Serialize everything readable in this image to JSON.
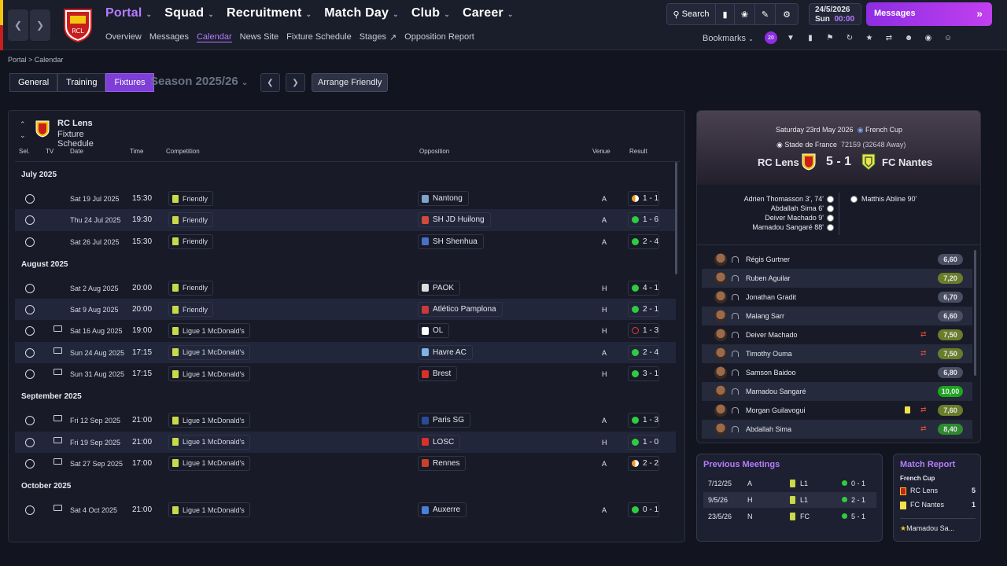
{
  "nav": {
    "main_menu": [
      {
        "label": "Portal"
      },
      {
        "label": "Squad"
      },
      {
        "label": "Recruitment"
      },
      {
        "label": "Match Day"
      },
      {
        "label": "Club"
      },
      {
        "label": "Career"
      }
    ],
    "sub_menu": [
      "Overview",
      "Messages",
      "Calendar",
      "News Site",
      "Fixture Schedule",
      "Stages",
      "Opposition Report"
    ],
    "active_sub": "Calendar",
    "search_label": "Search",
    "date": "24/5/2026",
    "day": "Sun",
    "clock": "00:00",
    "messages_label": "Messages",
    "bookmarks_label": "Bookmarks",
    "bookmark_badge": "20"
  },
  "breadcrumb": {
    "root": "Portal",
    "current": "Calendar"
  },
  "filters": {
    "tabs": [
      "General",
      "Training",
      "Fixtures"
    ],
    "active": "Fixtures",
    "season": "Season 2025/26",
    "arrange_label": "Arrange Friendly"
  },
  "schedule": {
    "club": "RC Lens",
    "subtitle": "Fixture Schedule",
    "columns": [
      "Sel.",
      "TV",
      "Date",
      "Time",
      "Competition",
      "Opposition",
      "Venue",
      "Result"
    ],
    "months": [
      {
        "name": "July 2025",
        "rows": [
          {
            "date": "Sat 19 Jul 2025",
            "time": "15:30",
            "comp": "Friendly",
            "opp": "Nantong",
            "venue": "A",
            "result": "1 - 1",
            "outcome": "d",
            "tv": false,
            "oppColor": "#7fa3c9"
          },
          {
            "date": "Thu 24 Jul 2025",
            "time": "19:30",
            "comp": "Friendly",
            "opp": "SH JD Huilong",
            "venue": "A",
            "result": "1 - 6",
            "outcome": "w",
            "tv": false,
            "oppColor": "#d24a3a"
          },
          {
            "date": "Sat 26 Jul 2025",
            "time": "15:30",
            "comp": "Friendly",
            "opp": "SH Shenhua",
            "venue": "A",
            "result": "2 - 4",
            "outcome": "w",
            "tv": false,
            "oppColor": "#4a6fc9"
          }
        ]
      },
      {
        "name": "August 2025",
        "rows": [
          {
            "date": "Sat 2 Aug 2025",
            "time": "20:00",
            "comp": "Friendly",
            "opp": "PAOK",
            "venue": "H",
            "result": "4 - 1",
            "outcome": "w",
            "tv": false,
            "oppColor": "#dddddd"
          },
          {
            "date": "Sat 9 Aug 2025",
            "time": "20:00",
            "comp": "Friendly",
            "opp": "Atlético Pamplona",
            "venue": "H",
            "result": "2 - 1",
            "outcome": "w",
            "tv": false,
            "oppColor": "#c93a3a"
          },
          {
            "date": "Sat 16 Aug 2025",
            "time": "19:00",
            "comp": "Ligue 1 McDonald's",
            "opp": "OL",
            "venue": "H",
            "result": "1 - 3",
            "outcome": "l",
            "tv": true,
            "oppColor": "#ffffff"
          },
          {
            "date": "Sun 24 Aug 2025",
            "time": "17:15",
            "comp": "Ligue 1 McDonald's",
            "opp": "Havre AC",
            "venue": "A",
            "result": "2 - 4",
            "outcome": "w",
            "tv": true,
            "oppColor": "#7fb2e5"
          },
          {
            "date": "Sun 31 Aug 2025",
            "time": "17:15",
            "comp": "Ligue 1 McDonald's",
            "opp": "Brest",
            "venue": "H",
            "result": "3 - 1",
            "outcome": "w",
            "tv": true,
            "oppColor": "#d9302a"
          }
        ]
      },
      {
        "name": "September 2025",
        "rows": [
          {
            "date": "Fri 12 Sep 2025",
            "time": "21:00",
            "comp": "Ligue 1 McDonald's",
            "opp": "Paris SG",
            "venue": "A",
            "result": "1 - 3",
            "outcome": "w",
            "tv": true,
            "oppColor": "#2a4a9a"
          },
          {
            "date": "Fri 19 Sep 2025",
            "time": "21:00",
            "comp": "Ligue 1 McDonald's",
            "opp": "LOSC",
            "venue": "H",
            "result": "1 - 0",
            "outcome": "w",
            "tv": true,
            "oppColor": "#d9302a"
          },
          {
            "date": "Sat 27 Sep 2025",
            "time": "17:00",
            "comp": "Ligue 1 McDonald's",
            "opp": "Rennes",
            "venue": "A",
            "result": "2 - 2",
            "outcome": "d",
            "tv": true,
            "oppColor": "#c9402a"
          }
        ]
      },
      {
        "name": "October 2025",
        "rows": [
          {
            "date": "Sat 4 Oct 2025",
            "time": "21:00",
            "comp": "Ligue 1 McDonald's",
            "opp": "Auxerre",
            "venue": "A",
            "result": "0 - 1",
            "outcome": "w",
            "tv": true,
            "oppColor": "#4a7fd9"
          }
        ]
      }
    ]
  },
  "match": {
    "date": "Saturday 23rd May 2026",
    "competition": "French Cup",
    "stadium": "Stade de France",
    "attendance": "72159",
    "away_count": "(32648 Away)",
    "home": "RC Lens",
    "away": "FC Nantes",
    "score": "5 - 1",
    "home_scorers": [
      "Adrien Thomasson 3', 74'",
      "Abdallah Sima 6'",
      "Deiver Machado 9'",
      "Mamadou Sangaré 88'"
    ],
    "away_scorers": [
      "Matthis Abline 90'"
    ],
    "players": [
      {
        "name": "Régis Gurtner",
        "rating": "6,60",
        "tier": 0,
        "sub": false,
        "yellow": false
      },
      {
        "name": "Ruben Aguilar",
        "rating": "7,20",
        "tier": 1,
        "sub": false,
        "yellow": false
      },
      {
        "name": "Jonathan Gradit",
        "rating": "6,70",
        "tier": 0,
        "sub": false,
        "yellow": false
      },
      {
        "name": "Malang Sarr",
        "rating": "6,60",
        "tier": 0,
        "sub": false,
        "yellow": false
      },
      {
        "name": "Deiver Machado",
        "rating": "7,50",
        "tier": 1,
        "sub": true,
        "yellow": false
      },
      {
        "name": "Timothy Ouma",
        "rating": "7,50",
        "tier": 1,
        "sub": true,
        "yellow": false
      },
      {
        "name": "Samson Baidoo",
        "rating": "6,80",
        "tier": 0,
        "sub": false,
        "yellow": false
      },
      {
        "name": "Mamadou Sangaré",
        "rating": "10,00",
        "tier": 3,
        "sub": false,
        "yellow": false
      },
      {
        "name": "Morgan Guilavogui",
        "rating": "7,60",
        "tier": 1,
        "sub": true,
        "yellow": true
      },
      {
        "name": "Abdallah Sima",
        "rating": "8,40",
        "tier": 2,
        "sub": true,
        "yellow": false
      }
    ]
  },
  "previous": {
    "title": "Previous Meetings",
    "rows": [
      {
        "date": "7/12/25",
        "venue": "A",
        "comp": "L1",
        "score": "0 - 1"
      },
      {
        "date": "9/5/26",
        "venue": "H",
        "comp": "L1",
        "score": "2 - 1"
      },
      {
        "date": "23/5/26",
        "venue": "N",
        "comp": "FC",
        "score": "5 - 1"
      }
    ]
  },
  "report": {
    "title": "Match Report",
    "competition": "French Cup",
    "home": "RC Lens",
    "home_goals": "5",
    "away": "FC Nantes",
    "away_goals": "1",
    "motm": "Mamadou Sa..."
  },
  "colors": {
    "accent": "#b47dff",
    "win": "#2ecc40",
    "loss": "#e53935",
    "draw": "#f39c2c"
  }
}
